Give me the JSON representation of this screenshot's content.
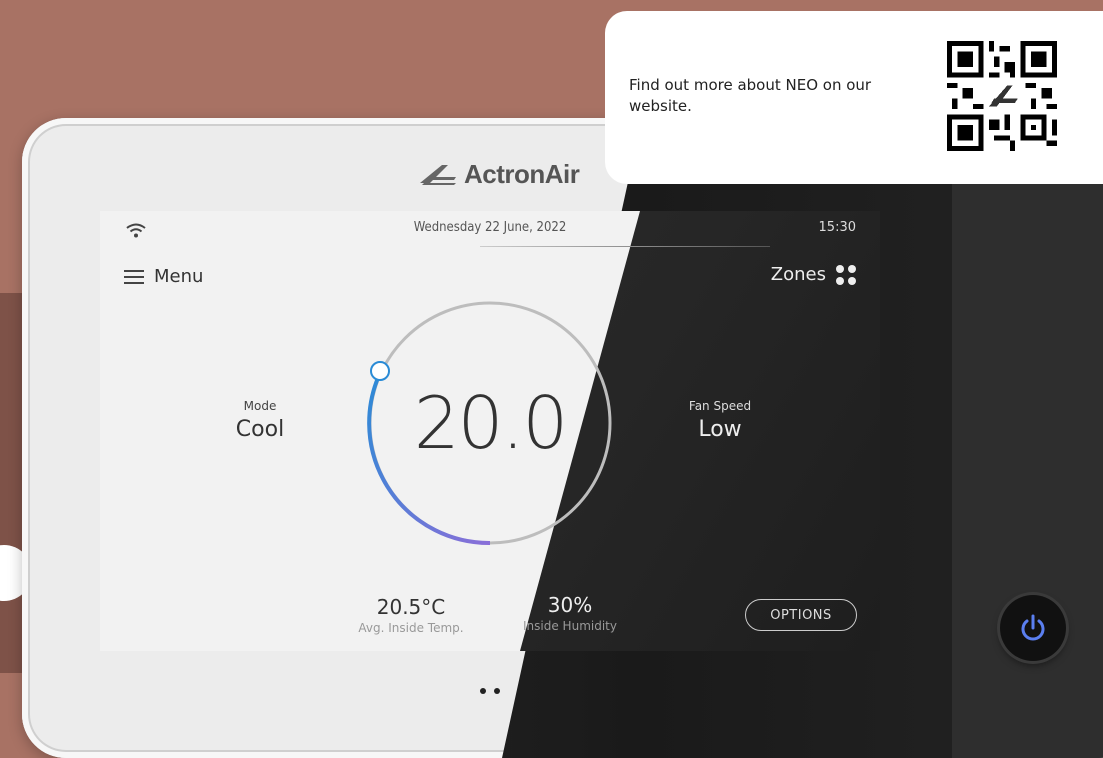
{
  "brand": {
    "logo_text": "ActronAir"
  },
  "status_bar": {
    "date": "Wednesday 22 June, 2022",
    "time": "15:30"
  },
  "nav": {
    "menu_label": "Menu",
    "zones_label": "Zones"
  },
  "mode": {
    "label": "Mode",
    "value": "Cool"
  },
  "setpoint": {
    "value": "20.0"
  },
  "fan": {
    "label": "Fan Speed",
    "value": "Low"
  },
  "readings": {
    "avg_temp_value": "20.5°C",
    "avg_temp_label": "Avg. Inside Temp.",
    "humidity_value": "30%",
    "humidity_label": "Inside Humidity"
  },
  "options_label": "OPTIONS",
  "promo": {
    "text": "Find out more about NEO on our website.",
    "qr_logo_text": "ActronAir"
  },
  "colors": {
    "background": "#a87264",
    "dial_start": "#2a8bd6",
    "dial_end": "#8a6fd8",
    "screen_light": "#f2f2f2",
    "screen_dark": "#262626"
  },
  "icons": [
    "wifi-icon",
    "menu-icon",
    "zones-icon",
    "power-icon",
    "qr-code-icon",
    "actronair-logo-icon"
  ]
}
